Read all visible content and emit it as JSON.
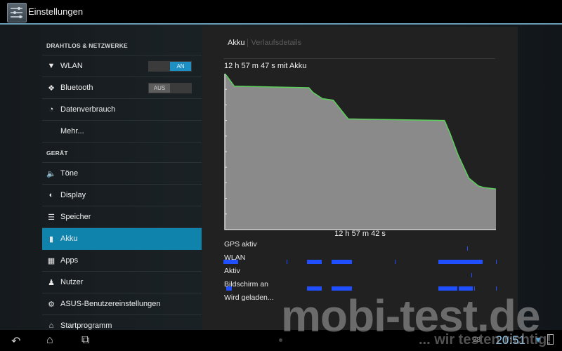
{
  "actionbar": {
    "title": "Einstellungen",
    "icon": "settings-sliders-icon"
  },
  "sidebar": {
    "sections": [
      {
        "header": "DRAHTLOS & NETZWERKE"
      },
      {
        "header": "GERÄT"
      }
    ],
    "items": [
      {
        "label": "WLAN",
        "icon": "wifi-icon",
        "toggle": "AN"
      },
      {
        "label": "Bluetooth",
        "icon": "bluetooth-icon",
        "toggle": "AUS"
      },
      {
        "label": "Datenverbrauch",
        "icon": "data-usage-icon"
      },
      {
        "label": "Mehr...",
        "icon": ""
      },
      {
        "label": "Töne",
        "icon": "speaker-icon"
      },
      {
        "label": "Display",
        "icon": "display-brightness-icon"
      },
      {
        "label": "Speicher",
        "icon": "storage-icon"
      },
      {
        "label": "Akku",
        "icon": "battery-icon",
        "selected": true
      },
      {
        "label": "Apps",
        "icon": "apps-icon"
      },
      {
        "label": "Nutzer",
        "icon": "user-icon"
      },
      {
        "label": "ASUS-Benutzereinstellungen",
        "icon": "gear-icon"
      },
      {
        "label": "Startprogramm",
        "icon": "launcher-icon"
      }
    ]
  },
  "panel": {
    "tabs": [
      {
        "label": "Akku",
        "active": true
      },
      {
        "label": "Verlaufsdetails",
        "active": false
      }
    ],
    "duration_label": "12 h 57 m 47 s mit Akku",
    "x_label": "12 h 57 m 42 s",
    "rows": [
      {
        "label": "GPS aktiv"
      },
      {
        "label": "WLAN"
      },
      {
        "label": "Aktiv"
      },
      {
        "label": "Bildschirm an"
      },
      {
        "label": "Wird geladen..."
      }
    ]
  },
  "chart_data": {
    "type": "area",
    "title": "12 h 57 m 47 s mit Akku",
    "xlabel": "12 h 57 m 42 s",
    "ylabel": "",
    "xlim": [
      0,
      1
    ],
    "ylim": [
      0,
      100
    ],
    "x": [
      0,
      0.01,
      0.035,
      0.31,
      0.325,
      0.36,
      0.4,
      0.455,
      0.81,
      0.83,
      0.86,
      0.9,
      0.935,
      0.955,
      1.0
    ],
    "y": [
      100,
      98,
      92,
      91,
      88,
      84,
      83,
      71,
      70,
      62,
      48,
      33,
      28,
      27,
      26
    ],
    "line_color": "#5cd05c",
    "fill_color": "#8a8a8a",
    "activity": {
      "wlan": [
        [
          0.0,
          0.055
        ],
        [
          0.23,
          0.232
        ],
        [
          0.305,
          0.36
        ],
        [
          0.395,
          0.47
        ],
        [
          0.625,
          0.628
        ],
        [
          0.785,
          0.945
        ],
        [
          0.995,
          0.997
        ]
      ],
      "aktiv": [
        [
          0.905,
          0.907
        ]
      ],
      "bildschirm_an": [
        [
          0.01,
          0.03
        ],
        [
          0.305,
          0.36
        ],
        [
          0.395,
          0.47
        ],
        [
          0.785,
          0.855
        ],
        [
          0.86,
          0.91
        ],
        [
          0.915,
          0.918
        ],
        [
          0.995,
          0.997
        ]
      ],
      "gps_aktiv": [
        [
          0.89,
          0.892
        ]
      ]
    }
  },
  "navbar": {
    "back": "back-icon",
    "home": "home-icon",
    "recents": "recents-icon",
    "time": "20:51",
    "notification": "28"
  },
  "watermark": {
    "text": "mobi-test.de",
    "tagline": "... wir testen richtig!"
  }
}
